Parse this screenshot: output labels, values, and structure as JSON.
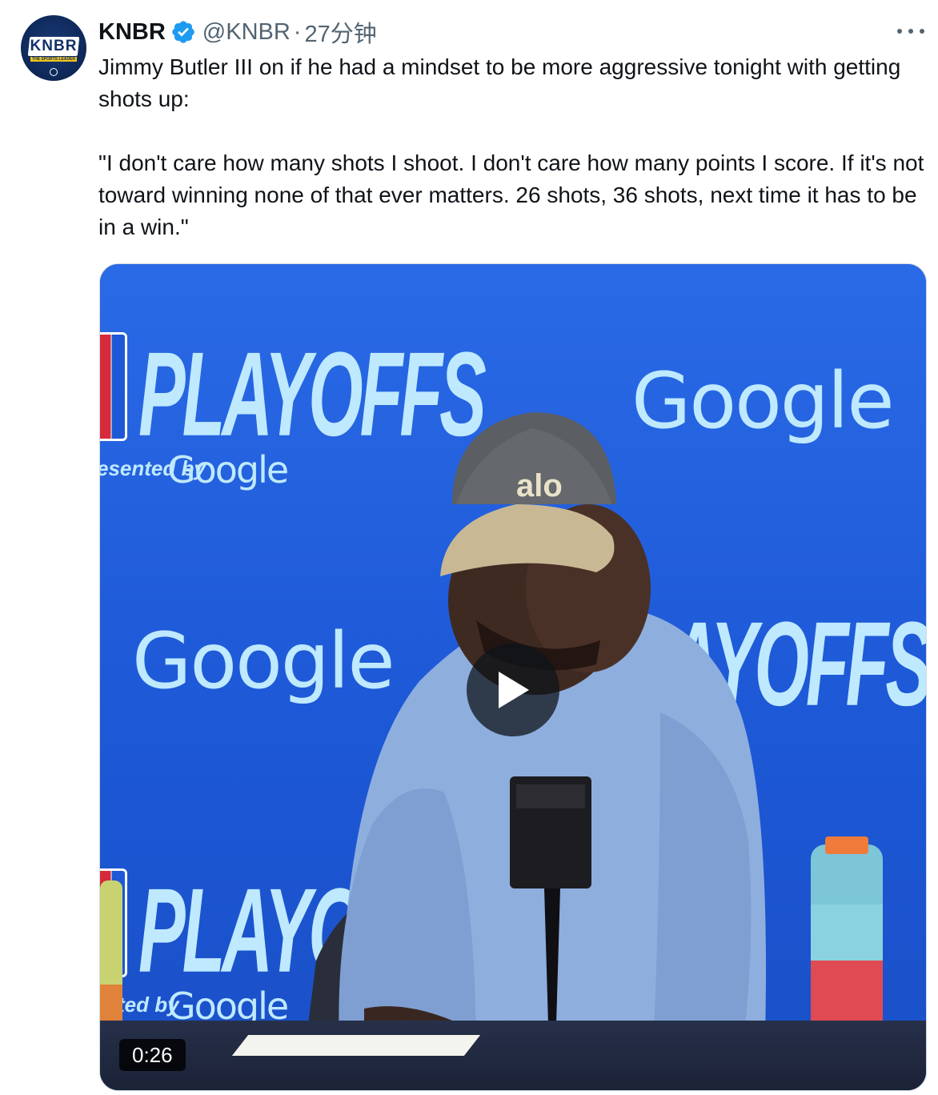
{
  "author": {
    "display_name": "KNBR",
    "handle": "@KNBR",
    "separator": "·",
    "time": "27分钟",
    "avatar_logo": "KNBR",
    "avatar_tagline": "THE SPORTS LEADER",
    "verified_color": "#1d9bf0"
  },
  "tweet": {
    "text_line1": "Jimmy Butler III on if he had a mindset to be more aggressive tonight with getting shots up:",
    "text_quote": "\"I don't care how many shots I shoot. I don't care how many points I score. If it's not toward winning none of that ever matters. 26 shots, 36 shots, next time it has to be in a win.\""
  },
  "media": {
    "type": "video",
    "duration": "0:26",
    "backdrop_playoffs": "PLAYOFFS",
    "backdrop_playoffs_partial": "PLAYO",
    "backdrop_playoffs_partial_right": "LAYOFFS",
    "backdrop_presented": "esented by",
    "backdrop_presented_2": "ted by",
    "backdrop_google": "Google",
    "cap_text": "alo",
    "backdrop_color": "#1f5bd6",
    "sweater_color": "#8eaede",
    "cap_color": "#5b5e62"
  },
  "icons": {
    "more": "more-horizontal-icon",
    "verified": "verified-badge-icon",
    "play": "play-icon"
  }
}
